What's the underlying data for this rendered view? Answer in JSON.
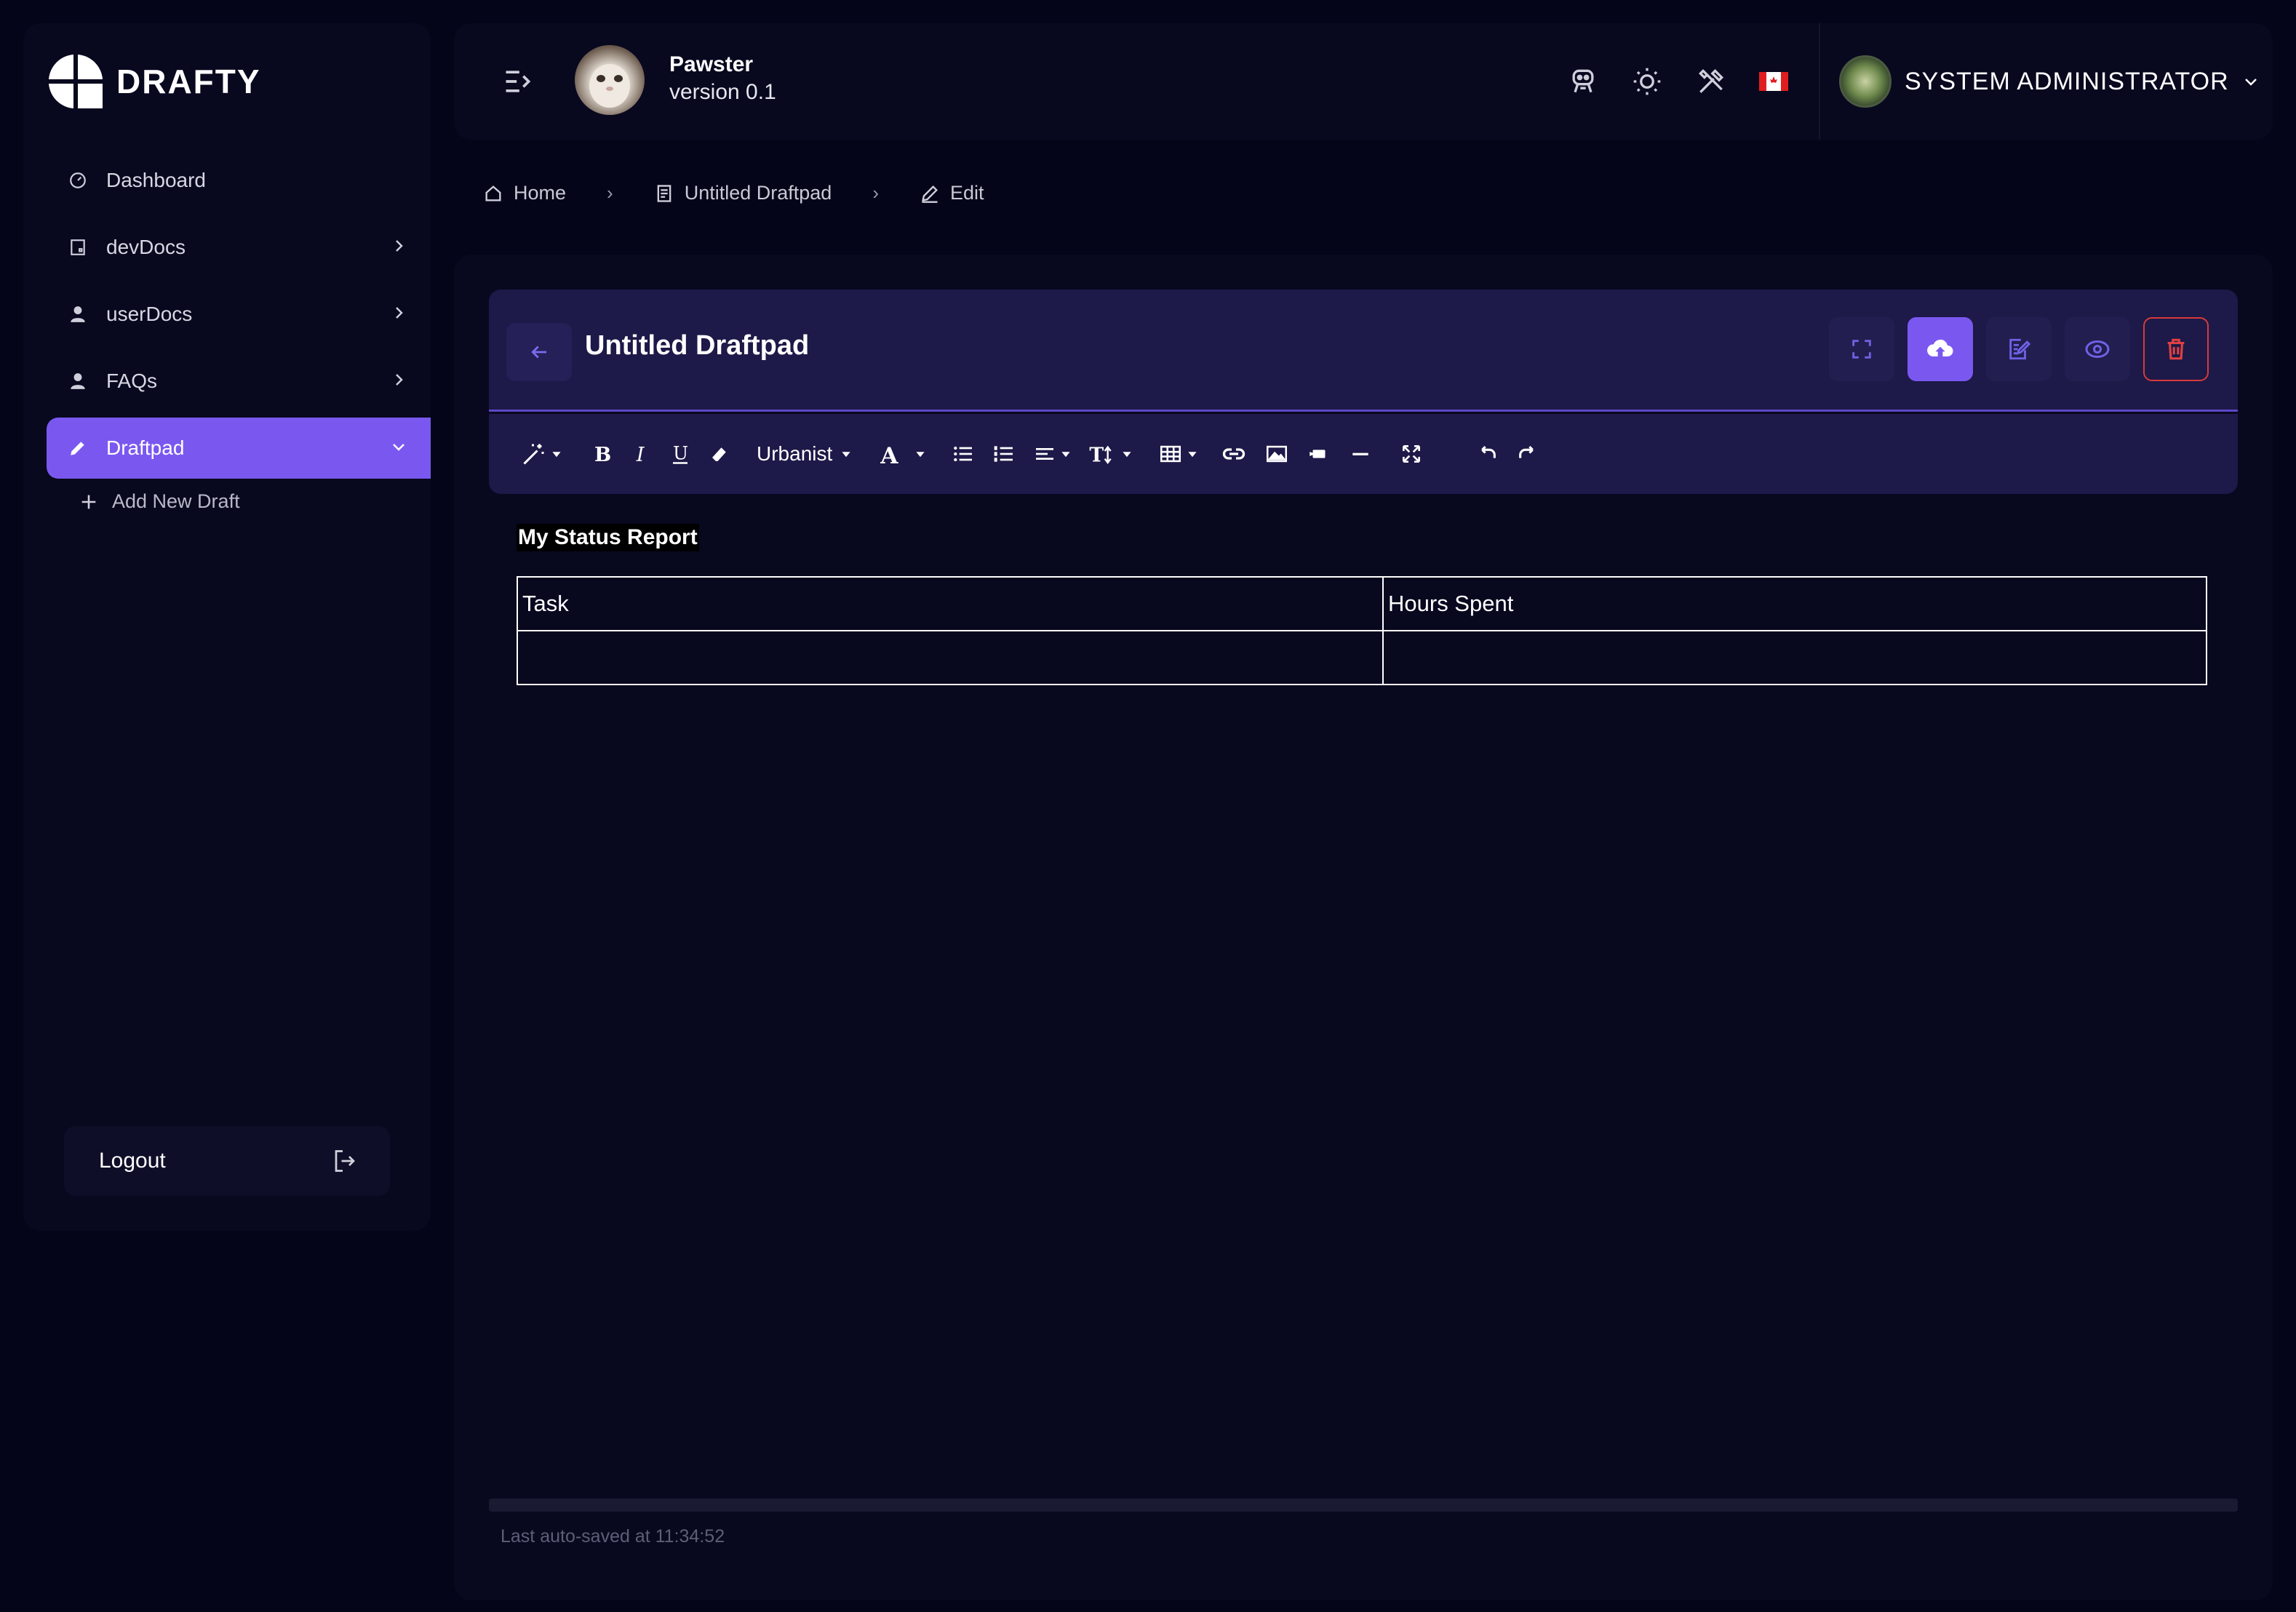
{
  "app": {
    "logo_text": "DRAFTY",
    "name": "Pawster",
    "version": "version 0.1"
  },
  "sidebar": {
    "items": [
      {
        "label": "Dashboard",
        "icon": "gauge-icon",
        "has_children": false
      },
      {
        "label": "devDocs",
        "icon": "document-icon",
        "has_children": true
      },
      {
        "label": "userDocs",
        "icon": "user-icon",
        "has_children": true
      },
      {
        "label": "FAQs",
        "icon": "user-icon",
        "has_children": true
      },
      {
        "label": "Draftpad",
        "icon": "pencil-icon",
        "has_children": true,
        "active": true
      }
    ],
    "add_new": "Add New Draft",
    "logout": "Logout"
  },
  "header": {
    "icons": [
      "robot-icon",
      "sun-icon",
      "tools-icon",
      "canada-flag-icon"
    ],
    "user_name": "SYSTEM ADMINISTRATOR"
  },
  "breadcrumb": [
    {
      "label": "Home",
      "icon": "home-icon"
    },
    {
      "label": "Untitled Draftpad",
      "icon": "document-icon"
    },
    {
      "label": "Edit",
      "icon": "edit-icon"
    }
  ],
  "editor": {
    "title": "Untitled Draftpad",
    "actions": [
      "fullscreen-icon",
      "cloud-upload-icon",
      "edit-note-icon",
      "eye-icon",
      "trash-icon"
    ],
    "toolbar": {
      "font_name": "Urbanist",
      "tools": [
        "magic-wand",
        "bold",
        "italic",
        "underline",
        "eraser",
        "font-family",
        "font-color",
        "bullet-list",
        "numbered-list",
        "align",
        "font-size",
        "table",
        "link",
        "image",
        "video",
        "horizontal-rule",
        "fullscreen",
        "undo",
        "redo"
      ]
    },
    "content": {
      "heading": "My Status Report",
      "table": {
        "headers": [
          "Task",
          "Hours Spent"
        ],
        "rows": [
          [
            "",
            ""
          ]
        ]
      }
    },
    "autosave": "Last auto-saved at 11:34:52"
  },
  "colors": {
    "background": "#050519",
    "panel": "#08081f",
    "accent": "#7a58f0",
    "editor_header": "#1d1948",
    "danger": "#d73a3a"
  }
}
